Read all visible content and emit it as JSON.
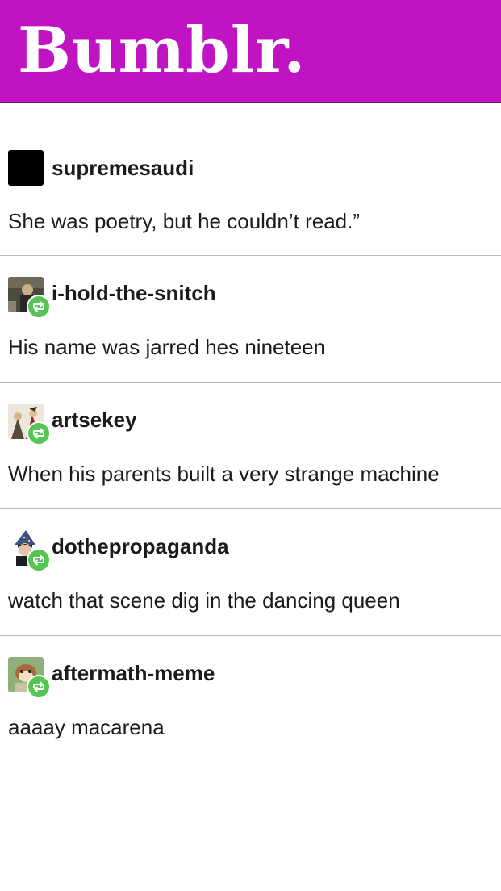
{
  "app": {
    "logo": "Bumblr."
  },
  "posts": [
    {
      "username": "supremesaudi",
      "text": "She was poetry, but he couldn’t read.”",
      "reblogged": false,
      "avatar": "black-square-avatar"
    },
    {
      "username": "i-hold-the-snitch",
      "text": "His name was jarred hes nineteen",
      "reblogged": true,
      "avatar": "photo-avatar"
    },
    {
      "username": "artsekey",
      "text": "When his parents built a very strange machine",
      "reblogged": true,
      "avatar": "illustration-avatar"
    },
    {
      "username": "dothepropaganda",
      "text": "watch that scene dig in the dancing queen",
      "reblogged": true,
      "avatar": "wizard-hat-avatar"
    },
    {
      "username": "aftermath-meme",
      "text": "aaaay macarena",
      "reblogged": true,
      "avatar": "cartoon-animal-avatar"
    }
  ],
  "colors": {
    "header": "#c014c2",
    "reblog_badge": "#56c556"
  }
}
